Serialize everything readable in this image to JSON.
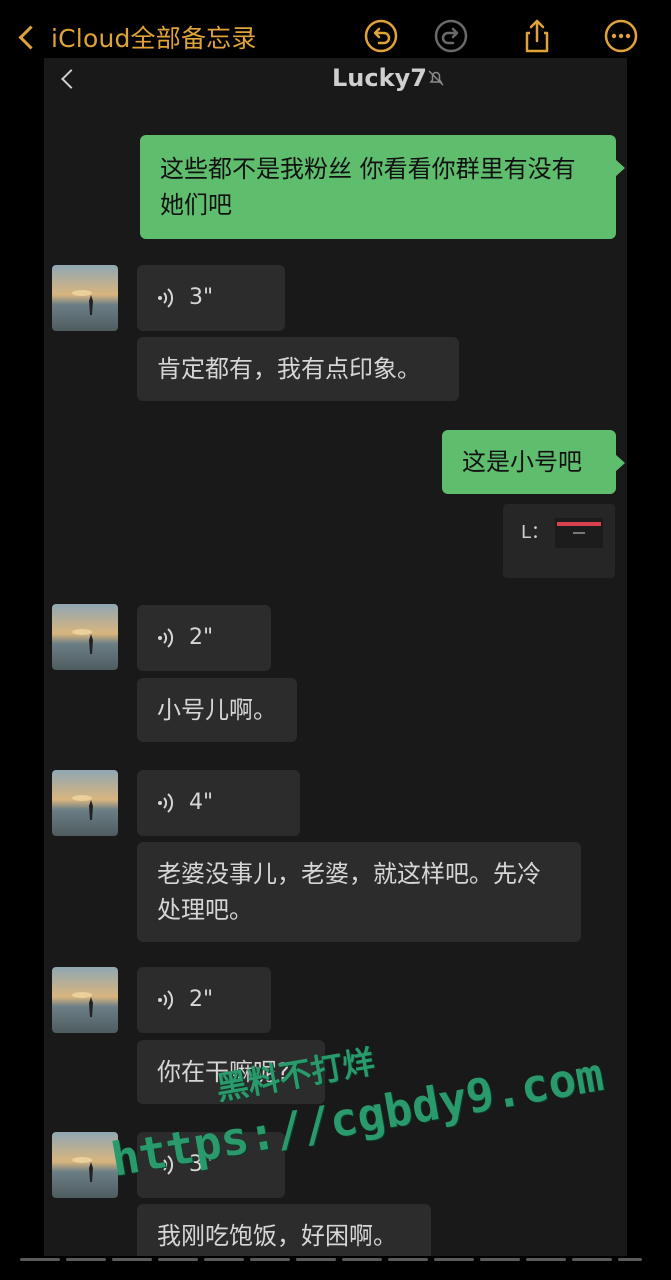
{
  "notes_toolbar": {
    "back_label": "iCloud全部备忘录",
    "accent_color": "#e0a33a",
    "icons": [
      "undo-icon",
      "redo-icon",
      "share-icon",
      "more-icon"
    ]
  },
  "chat": {
    "contact_name": "Lucky7",
    "messages": [
      {
        "direction": "out",
        "type": "text",
        "text": "这些都不是我粉丝 你看看你群里有没有她们吧"
      },
      {
        "direction": "in",
        "type": "voice",
        "duration": "3\""
      },
      {
        "direction": "in",
        "type": "text",
        "text": "肯定都有，我有点印象。"
      },
      {
        "direction": "out",
        "type": "text",
        "text": "这是小号吧"
      },
      {
        "direction": "out",
        "type": "image",
        "thumb_label": "L："
      },
      {
        "direction": "in",
        "type": "voice",
        "duration": "2\""
      },
      {
        "direction": "in",
        "type": "text",
        "text": "小号儿啊。"
      },
      {
        "direction": "in",
        "type": "voice",
        "duration": "4\""
      },
      {
        "direction": "in",
        "type": "text",
        "text": "老婆没事儿，老婆，就这样吧。先冷处理吧。"
      },
      {
        "direction": "in",
        "type": "voice",
        "duration": "2\""
      },
      {
        "direction": "in",
        "type": "text",
        "text": "你在干嘛呢?"
      },
      {
        "direction": "in",
        "type": "voice",
        "duration": "3\""
      },
      {
        "direction": "in",
        "type": "text",
        "text": "我刚吃饱饭，好困啊。"
      }
    ],
    "out_bubble_color": "#5fbd6e",
    "in_bubble_color": "#2c2c2c"
  },
  "watermark": {
    "line1": "黑料不打烊",
    "line2": "https://cgbdy9.com",
    "color": "#2a9a6c"
  }
}
